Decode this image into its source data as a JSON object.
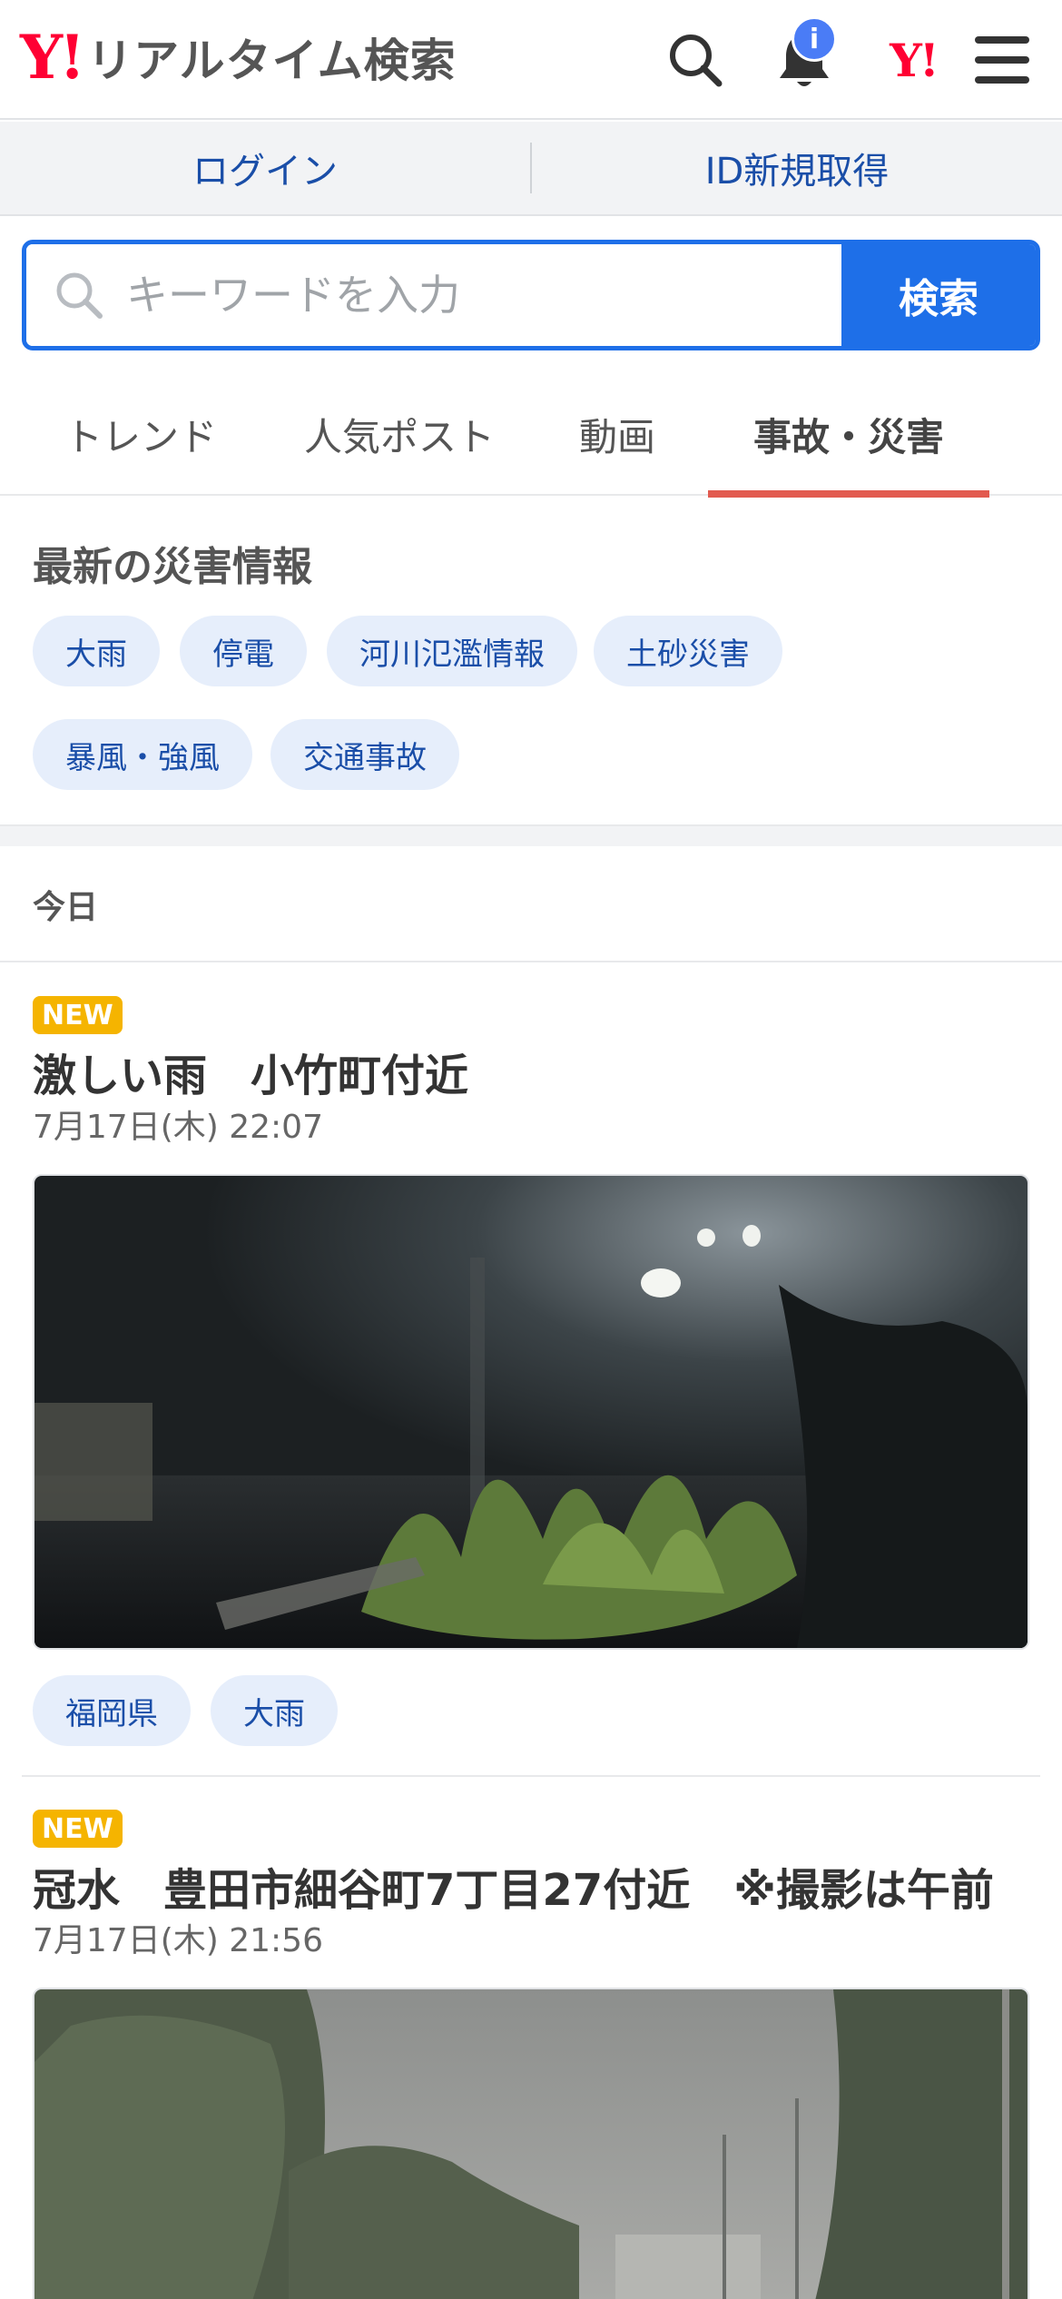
{
  "header": {
    "logo_mark": "Y!",
    "logo_text": "リアルタイム検索",
    "notification_badge": "i",
    "yahoo_mark": "Y!"
  },
  "loginbar": {
    "login": "ログイン",
    "register": "ID新規取得"
  },
  "search": {
    "placeholder": "キーワードを入力",
    "button": "検索"
  },
  "tabs": [
    {
      "label": "トレンド",
      "active": false
    },
    {
      "label": "人気ポスト",
      "active": false
    },
    {
      "label": "動画",
      "active": false
    },
    {
      "label": "事故・災害",
      "active": true
    }
  ],
  "disaster": {
    "title": "最新の災害情報",
    "chips": [
      "大雨",
      "停電",
      "河川氾濫情報",
      "土砂災害",
      "暴風・強風",
      "交通事故"
    ]
  },
  "day_label": "今日",
  "posts": [
    {
      "badge": "NEW",
      "title": "激しい雨　小竹町付近",
      "time": "7月17日(木) 22:07",
      "tags": [
        "福岡県",
        "大雨"
      ]
    },
    {
      "badge": "NEW",
      "title": "冠水　豊田市細谷町7丁目27付近　※撮影は午前",
      "time": "7月17日(木) 21:56",
      "tags": []
    }
  ],
  "colors": {
    "brand_red": "#ff0033",
    "accent_blue": "#1e6fe8",
    "link_blue": "#1a4ea8",
    "chip_bg": "#e6eefb",
    "tab_underline": "#e25a4f",
    "new_badge": "#f5b400"
  }
}
